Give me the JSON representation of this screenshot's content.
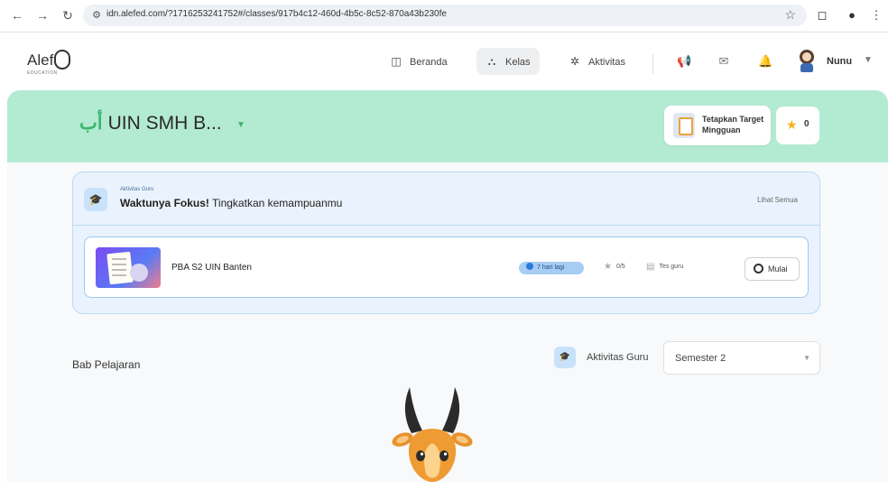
{
  "browser": {
    "url": "idn.alefed.com/?1716253241752#/classes/917b4c12-460d-4b5c-8c52-870a43b230fe"
  },
  "header": {
    "logo_text": "Alef",
    "logo_sub": "EDUCATION",
    "nav": [
      {
        "label": "Beranda",
        "icon": "book-icon",
        "active": false
      },
      {
        "label": "Kelas",
        "icon": "class-icon",
        "active": true
      },
      {
        "label": "Aktivitas",
        "icon": "activity-icon",
        "active": false
      }
    ],
    "user_name": "Nunu"
  },
  "banner": {
    "arabic_prefix": "أب",
    "class_name": "UIN SMH B...",
    "target_label": "Tetapkan Target Mingguan",
    "stars": "0",
    "color": "#b3ead2"
  },
  "activity": {
    "subtitle": "Aktivitas Guru",
    "title_bold": "Waktunya Fokus!",
    "title_rest": "Tingkatkan kemampuanmu",
    "see_all": "Lihat Semua",
    "lesson": {
      "title": "PBA S2 UIN Banten",
      "due": "7 hari lagi",
      "score": "0/5",
      "type": "Tes guru",
      "start_label": "Mulai"
    }
  },
  "chapters": {
    "title": "Bab Pelajaran",
    "filter_label": "Aktivitas Guru",
    "semester": "Semester 2"
  }
}
